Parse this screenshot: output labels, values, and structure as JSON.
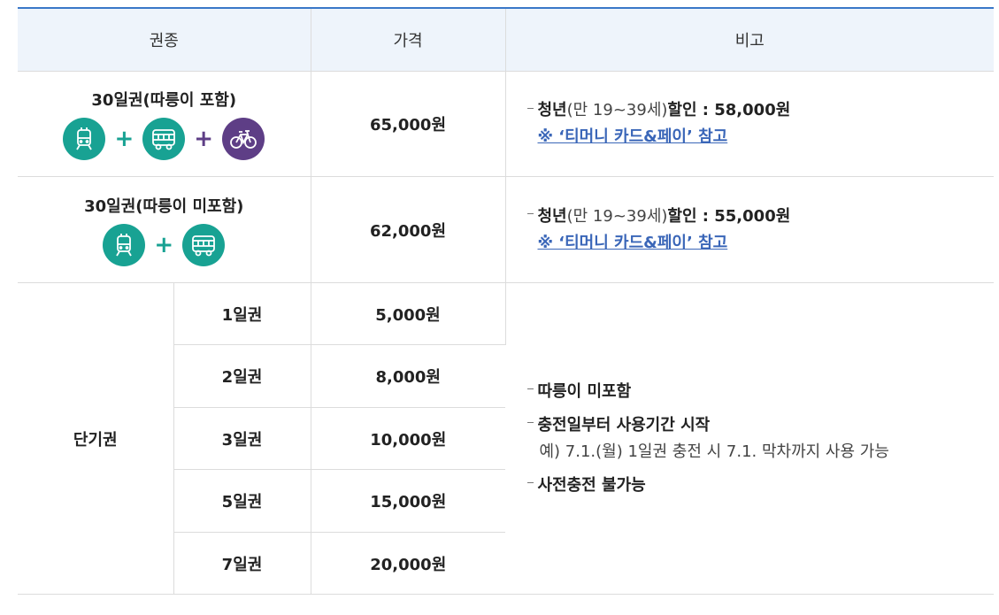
{
  "header": {
    "col1": "권종",
    "col2": "가격",
    "col3": "비고"
  },
  "rows": [
    {
      "name": "30일권(따릉이 포함)",
      "price": "65,000원",
      "icons": [
        "subway-icon",
        "bus-icon",
        "bicycle-icon"
      ],
      "note": {
        "bold1": "청년",
        "paren": "(만 19~39세)",
        "bold2": "할인 : 58,000원",
        "link": "※ ‘티머니 카드&페이’ 참고"
      }
    },
    {
      "name": "30일권(따릉이 미포함)",
      "price": "62,000원",
      "icons": [
        "subway-icon",
        "bus-icon"
      ],
      "note": {
        "bold1": "청년",
        "paren": "(만 19~39세)",
        "bold2": "할인 : 55,000원",
        "link": "※ ‘티머니 카드&페이’ 참고"
      }
    }
  ],
  "short_term": {
    "label": "단기권",
    "items": [
      {
        "name": "1일권",
        "price": "5,000원"
      },
      {
        "name": "2일권",
        "price": "8,000원"
      },
      {
        "name": "3일권",
        "price": "10,000원"
      },
      {
        "name": "5일권",
        "price": "15,000원"
      },
      {
        "name": "7일권",
        "price": "20,000원"
      }
    ],
    "notes": {
      "n1": "따릉이 미포함",
      "n2": "충전일부터 사용기간 시작",
      "n2_sub": "예) 7.1.(월) 1일권 충전 시 7.1. 막차까지 사용 가능",
      "n3": "사전충전 불가능"
    }
  },
  "colors": {
    "teal": "#18a293",
    "purple": "#5e3e86",
    "header_bg": "#eef4fb",
    "link": "#3a66b8",
    "top_border": "#3a78c8"
  },
  "plus_sign": "+"
}
